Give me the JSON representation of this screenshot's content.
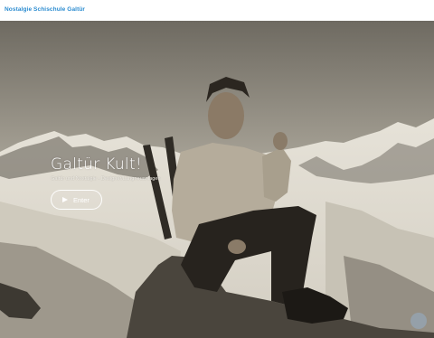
{
  "header": {
    "site_title": "Nostalgie Schischule Galtür"
  },
  "hero": {
    "title": "Galtür Kult!",
    "subtitle": "Galtür und Nostalgie - Designer/Langneuanlagen",
    "enter_label": "Enter"
  },
  "icons": {
    "play": "play-icon",
    "scroll": "scroll-up-icon"
  },
  "colors": {
    "title_blue": "#2a8bd0"
  }
}
